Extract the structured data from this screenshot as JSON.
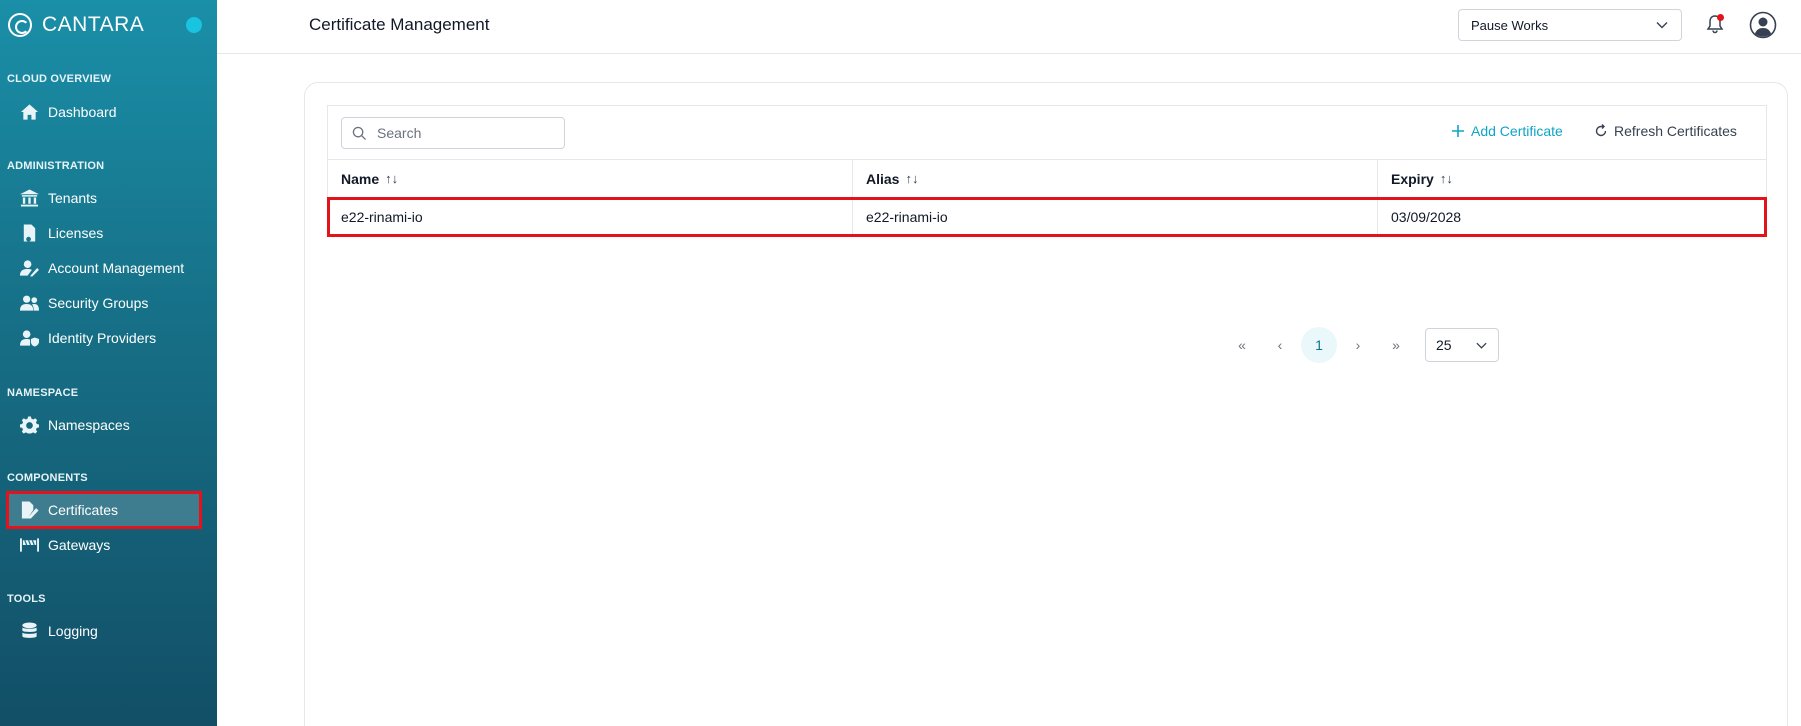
{
  "brand": {
    "name": "CANTARA"
  },
  "sidebar": {
    "sections": {
      "cloud_overview": "CLOUD OVERVIEW",
      "administration": "ADMINISTRATION",
      "namespace": "NAMESPACE",
      "components": "COMPONENTS",
      "tools": "TOOLS"
    },
    "items": {
      "dashboard": "Dashboard",
      "tenants": "Tenants",
      "licenses": "Licenses",
      "account_management": "Account Management",
      "security_groups": "Security Groups",
      "identity_providers": "Identity Providers",
      "namespaces": "Namespaces",
      "certificates": "Certificates",
      "gateways": "Gateways",
      "logging": "Logging"
    },
    "active_item": "Certificates"
  },
  "header": {
    "title": "Certificate Management",
    "tenant_selected": "Pause Works"
  },
  "toolbar": {
    "search_placeholder": "Search",
    "add_label": "Add Certificate",
    "refresh_label": "Refresh Certificates"
  },
  "table": {
    "columns": [
      "Name",
      "Alias",
      "Expiry"
    ],
    "rows": [
      {
        "name": "e22-rinami-io",
        "alias": "e22-rinami-io",
        "expiry": "03/09/2028"
      }
    ]
  },
  "pagination": {
    "first": "«",
    "prev": "‹",
    "current_page": "1",
    "next": "›",
    "last": "»",
    "page_size": "25"
  },
  "colors": {
    "accent": "#0ea5c6",
    "sidebar_top": "#1a8fa8",
    "sidebar_bottom": "#124f66",
    "highlight": "#e3121b"
  }
}
